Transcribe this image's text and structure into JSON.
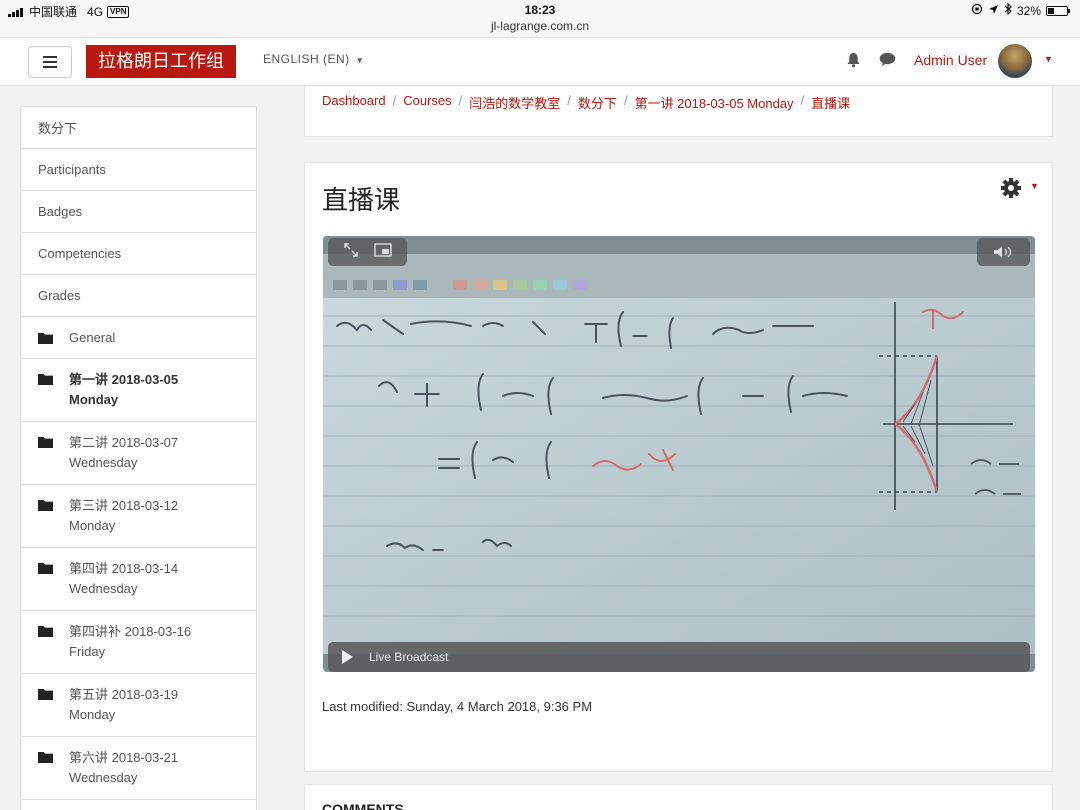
{
  "status_bar": {
    "carrier": "中国联通",
    "network": "4G",
    "vpn": "VPN",
    "time": "18:23",
    "url": "jl-lagrange.com.cn",
    "battery": "32%",
    "battery_level": 0.32
  },
  "navbar": {
    "brand": "拉格朗日工作组",
    "language": "ENGLISH (EN)",
    "user_name": "Admin User",
    "bell_icon": "bell-icon",
    "message_icon": "chat-bubble-icon",
    "menu_icon": "hamburger-icon"
  },
  "sidebar": {
    "items": [
      {
        "label": "数分下"
      },
      {
        "label": "Participants"
      },
      {
        "label": "Badges"
      },
      {
        "label": "Competencies"
      },
      {
        "label": "Grades"
      }
    ],
    "sections": [
      {
        "title": "General",
        "subtitle": ""
      },
      {
        "title": "第一讲 2018-03-05",
        "subtitle": "Monday"
      },
      {
        "title": "第二讲 2018-03-07",
        "subtitle": "Wednesday"
      },
      {
        "title": "第三讲 2018-03-12",
        "subtitle": "Monday"
      },
      {
        "title": "第四讲 2018-03-14",
        "subtitle": "Wednesday"
      },
      {
        "title": "第四讲补 2018-03-16",
        "subtitle": "Friday"
      },
      {
        "title": "第五讲 2018-03-19",
        "subtitle": "Monday"
      },
      {
        "title": "第六讲 2018-03-21",
        "subtitle": "Wednesday"
      }
    ]
  },
  "breadcrumb": [
    "Dashboard",
    "Courses",
    "闫浩的数学教室",
    "数分下",
    "第一讲 2018-03-05 Monday",
    "直播课"
  ],
  "main": {
    "title": "直播课",
    "player": {
      "live_label": "Live Broadcast"
    },
    "last_modified": "Last modified: Sunday, 4 March 2018, 9:36 PM"
  },
  "comments": {
    "title": "COMMENTS"
  },
  "colors": {
    "brand": "#b9180f",
    "link": "#b9180f",
    "page_bg": "#f2f2f2"
  }
}
